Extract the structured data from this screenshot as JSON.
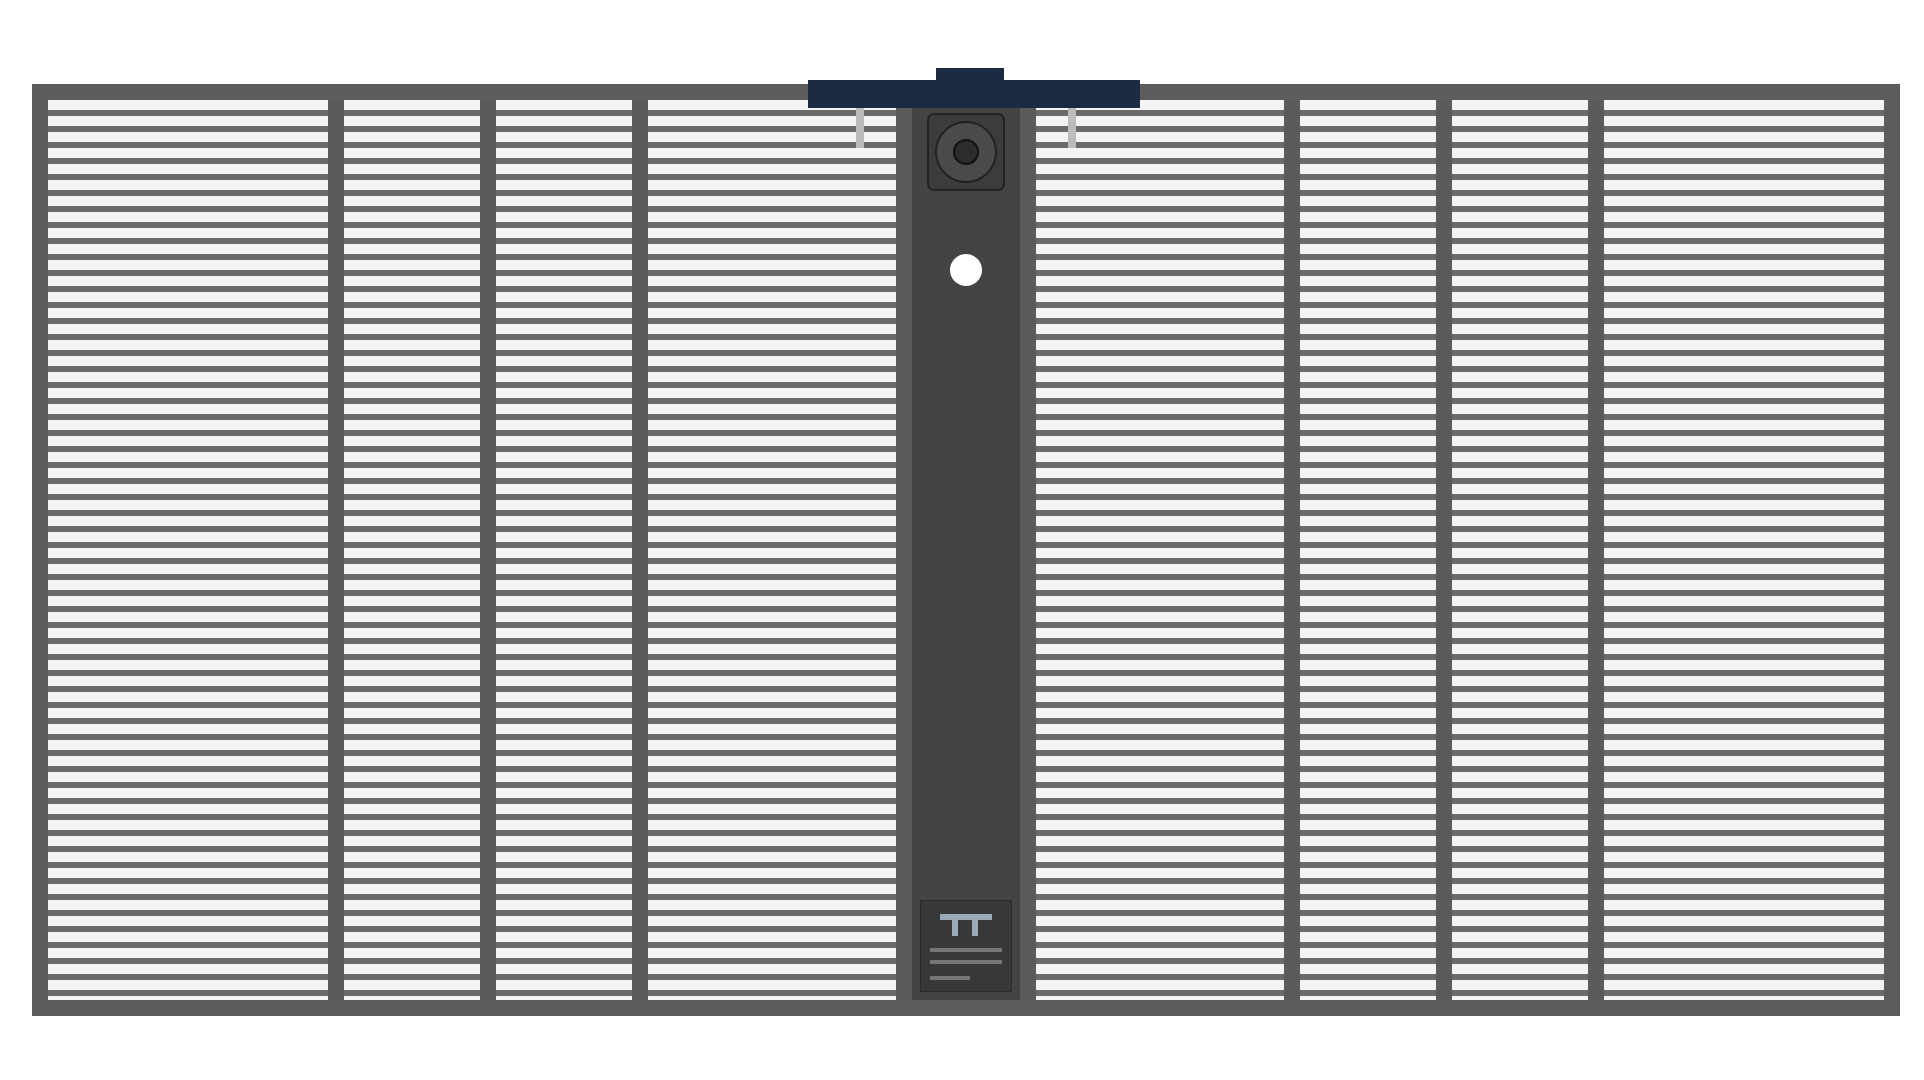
{
  "panel": {
    "modules": [
      {
        "kind": "wide"
      },
      {
        "kind": "narrow"
      },
      {
        "kind": "narrow"
      },
      {
        "kind": "medium"
      },
      {
        "kind": "spine"
      },
      {
        "kind": "medium"
      },
      {
        "kind": "narrow"
      },
      {
        "kind": "narrow"
      },
      {
        "kind": "wide"
      }
    ]
  }
}
